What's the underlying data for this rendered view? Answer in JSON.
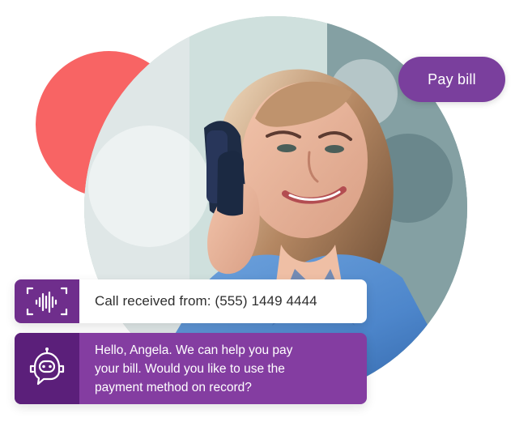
{
  "hero": {
    "accent_color": "#f86464",
    "brand_purple": "#7a3f9d",
    "dark_purple": "#5b1f7a",
    "photo_subject": "woman talking on a smartphone outdoors"
  },
  "actions": {
    "pay_bill_label": "Pay bill"
  },
  "call_notification": {
    "icon": "voice-waveform-icon",
    "text": "Call received from: (555) 1449 4444"
  },
  "assistant_message": {
    "icon": "chatbot-icon",
    "lines": [
      "Hello, Angela. We can help you pay",
      "your bill. Would you like to use the",
      "payment method on record?"
    ]
  }
}
